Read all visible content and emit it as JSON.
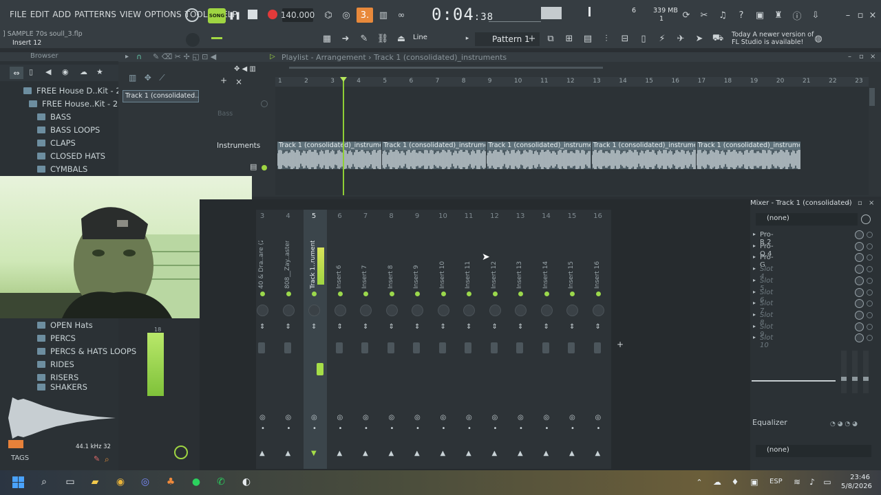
{
  "menu": [
    "FILE",
    "EDIT",
    "ADD",
    "PATTERNS",
    "VIEW",
    "OPTIONS",
    "TOOLS",
    "HELP"
  ],
  "hint": {
    "file": "] SAMPLE 70s soull_3.flp",
    "insert": "Insert 12"
  },
  "transport": {
    "song_badge": "SONG",
    "bpm": "140.000",
    "time_main": "0:04",
    "time_sub": "38",
    "mem": "339 MB",
    "cpu_voices": "6",
    "one": "1"
  },
  "snap": "Line",
  "pattern": "Pattern 1",
  "news": {
    "line1": "Today  A newer version of",
    "line2": "FL Studio is available!"
  },
  "browser": {
    "title": "Browser",
    "items": [
      "FREE House D..Kit - 2211",
      "FREE House..Kit - 2211",
      "BASS",
      "BASS LOOPS",
      "CLAPS",
      "CLOSED HATS",
      "CYMBALS",
      "OPEN Hats",
      "PERCS",
      "PERCS & HATS LOOPS",
      "RIDES",
      "RISERS",
      "SHAKERS"
    ],
    "sample_rate": "44.1 kHz",
    "bits": "32",
    "tags_label": "TAGS"
  },
  "playlist": {
    "title": "Playlist - Arrangement",
    "crumb": "Track 1 (consolidated)_instruments",
    "clip_source": "Track 1 (consolidated...",
    "track_labels": [
      "Bass",
      "Instruments"
    ],
    "ruler": [
      "1",
      "2",
      "3",
      "4",
      "5",
      "6",
      "7",
      "8",
      "9",
      "10",
      "11",
      "12",
      "13",
      "14",
      "15",
      "16",
      "17",
      "18",
      "19",
      "20",
      "21",
      "22",
      "23"
    ],
    "clip_name": "Track 1 (consolidated)_instruments",
    "clip_count": 5
  },
  "mixer": {
    "title": "Mixer - Track 1 (consolidated)",
    "channels": [
      {
        "num": "3",
        "name": "40 & Dra..are (2)"
      },
      {
        "num": "4",
        "name": "808__Zay..astered"
      },
      {
        "num": "5",
        "name": "Track 1..ruments"
      },
      {
        "num": "6",
        "name": "Insert 6"
      },
      {
        "num": "7",
        "name": "Insert 7"
      },
      {
        "num": "8",
        "name": "Insert 8"
      },
      {
        "num": "9",
        "name": "Insert 9"
      },
      {
        "num": "10",
        "name": "Insert 10"
      },
      {
        "num": "11",
        "name": "Insert 11"
      },
      {
        "num": "12",
        "name": "Insert 12"
      },
      {
        "num": "13",
        "name": "Insert 13"
      },
      {
        "num": "14",
        "name": "Insert 14"
      },
      {
        "num": "15",
        "name": "Insert 15"
      },
      {
        "num": "16",
        "name": "Insert 16"
      }
    ],
    "preset": "(none)",
    "slots": [
      "Pro-R 2",
      "Pro-Q 4",
      "Pro-G",
      "Slot 4",
      "Slot 5",
      "Slot 6",
      "Slot 7",
      "Slot 8",
      "Slot 9",
      "Slot 10"
    ],
    "eq_label": "Equalizer",
    "out_preset": "(none)"
  },
  "taskbar": {
    "lang": "ESP",
    "time": "23:46",
    "date": "5/8/2026"
  }
}
